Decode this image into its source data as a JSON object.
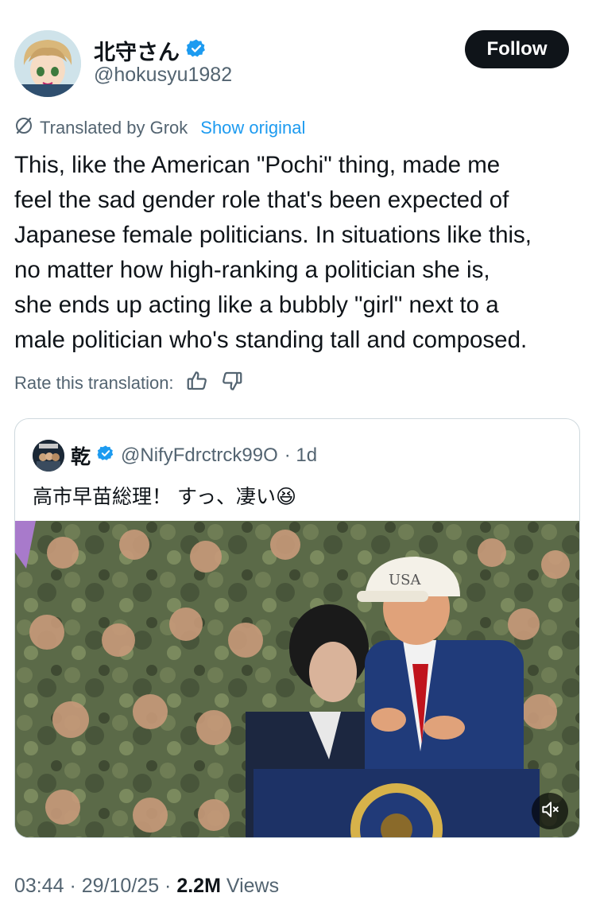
{
  "author": {
    "name": "北守さん",
    "handle": "@hokusyu1982",
    "avatar_badge": "FP",
    "verified_icon": "verified-badge-icon"
  },
  "follow_label": "Follow",
  "translation": {
    "label": "Translated by Grok",
    "show_original": "Show original",
    "icon": "grok-slash-icon"
  },
  "tweet_lines": [
    "This, like the American \"Pochi\" thing, made me",
    "feel the sad gender role that's been expected of",
    "Japanese female politicians. In situations like this,",
    "no matter how high-ranking a politician she is,",
    "she ends up acting like a bubbly \"girl\" next to a",
    "male politician who's standing tall and composed."
  ],
  "rate": {
    "label": "Rate this translation:",
    "up_icon": "thumbs-up-icon",
    "down_icon": "thumbs-down-icon"
  },
  "quote": {
    "name": "乾",
    "handle": "@NifyFdrctrck99O",
    "time": "· 1d",
    "text": "高市早苗総理！ すっ、凄い😆",
    "media_cap": "USA",
    "mute_icon": "mute-icon"
  },
  "meta": {
    "time": "03:44 · 29/10/25 · ",
    "views_count": "2.2M",
    "views_label": " Views"
  },
  "colors": {
    "text": "#0f1419",
    "secondary": "#536471",
    "link": "#1d9bf0",
    "verified": "#1d9bf0"
  }
}
